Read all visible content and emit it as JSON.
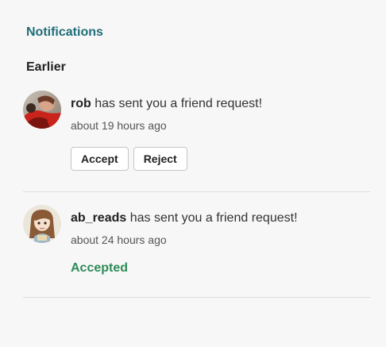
{
  "header": {
    "title": "Notifications",
    "section_label": "Earlier"
  },
  "colors": {
    "title": "#1f6e78",
    "accepted": "#2e8b57"
  },
  "notifications": [
    {
      "username": "rob",
      "message": " has sent you a friend request!",
      "time": "about 19 hours ago",
      "accept_label": "Accept",
      "reject_label": "Reject",
      "avatar": "photo-avatar"
    },
    {
      "username": "ab_reads",
      "message": " has sent you a friend request!",
      "time": "about 24 hours ago",
      "status": "Accepted",
      "avatar": "illustrated-girl-avatar"
    }
  ]
}
